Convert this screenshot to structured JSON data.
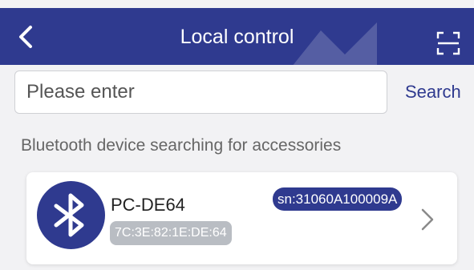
{
  "header": {
    "title": "Local control",
    "back_icon": "back-arrow-icon",
    "scan_icon": "scan-icon",
    "color": "#2f3a8f"
  },
  "search": {
    "placeholder": "Please enter",
    "value": "",
    "button_label": "Search"
  },
  "section_title": "Bluetooth device searching for accessories",
  "devices": [
    {
      "name": "PC-DE64",
      "mac": "7C:3E:82:1E:DE:64",
      "sn": "sn:31060A100009A",
      "icon": "bluetooth-icon"
    }
  ]
}
